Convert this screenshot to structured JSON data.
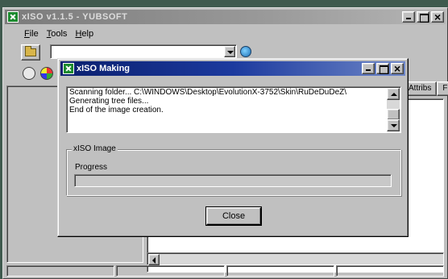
{
  "main_window": {
    "title": "xISO v1.1.5 - YUBSOFT",
    "menu": [
      {
        "label": "File"
      },
      {
        "label": "Tools"
      },
      {
        "label": "Help"
      }
    ],
    "list_columns": [
      "Attribs",
      "F"
    ]
  },
  "dialog": {
    "title": "xISO Making",
    "log": [
      "Scanning folder... C:\\WINDOWS\\Desktop\\EvolutionX-3752\\Skin\\RuDeDuDeZ\\",
      "Generating tree files...",
      "End of the image creation."
    ],
    "group_label": "xISO Image",
    "progress_label": "Progress",
    "progress_value": 0,
    "close_label": "Close"
  },
  "colors": {
    "dialog_title_bar": "#0a1f6e",
    "inactive_title_bar": "#7b7b7b",
    "window_face": "#c0c0c0"
  },
  "icons": [
    "app-icon",
    "folder-open-icon",
    "globe-icon",
    "burn-icon",
    "disc-icon",
    "minimize-icon",
    "maximize-icon",
    "close-icon",
    "scroll-up-icon",
    "scroll-down-icon",
    "scroll-left-icon",
    "dropdown-arrow-icon"
  ]
}
